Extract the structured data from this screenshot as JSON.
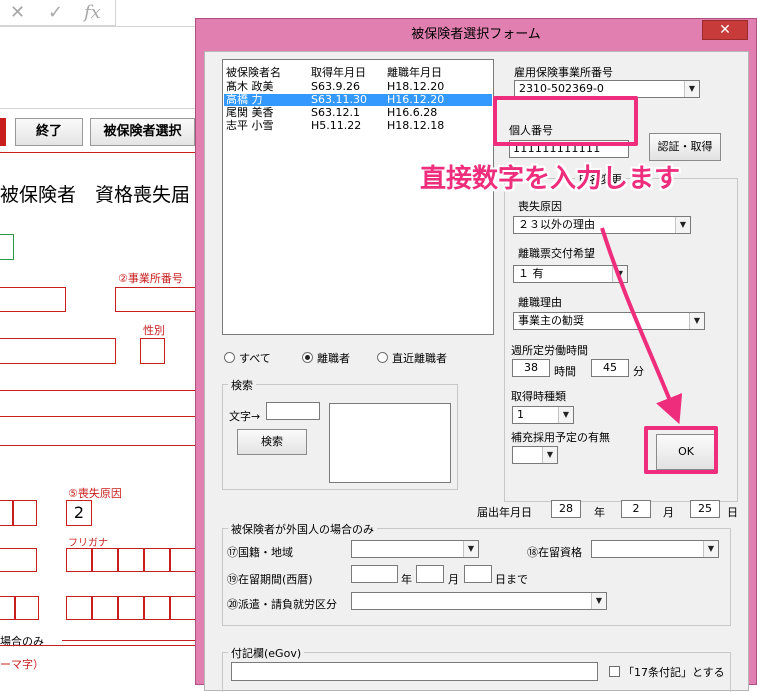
{
  "excel": {
    "toolbar": {
      "x": "✕",
      "check": "✓",
      "fx": "fx"
    },
    "buttons": {
      "exit": "終了",
      "select_insured": "被保険者選択"
    },
    "sheet_title": "被保険者　資格喪失届",
    "label_office_number": "②事業所番号",
    "label_gender": "性別",
    "label_loss_reason": "⑤喪失原因",
    "loss_reason_value": "2",
    "label_furigana": "フリガナ",
    "label_foreign_only": "場合のみ",
    "label_romaji": "ーマ字）"
  },
  "dialog": {
    "title": "被保険者選択フォーム",
    "close": "✕",
    "list": {
      "headers": [
        "被保険者名",
        "取得年月日",
        "離職年月日"
      ],
      "rows": [
        [
          "髙木 政美",
          "S63.9.26",
          "H18.12.20"
        ],
        [
          "高橋 力",
          "S63.11.30",
          "H16.12.20"
        ],
        [
          "尾関 美香",
          "S63.12.1",
          "H16.6.28"
        ],
        [
          "志平 小雪",
          "H5.11.22",
          "H18.12.18"
        ]
      ],
      "selected_index": 1
    },
    "filter": {
      "all": "すべて",
      "left": "離職者",
      "recent": "直近離職者",
      "selected": "left"
    },
    "search": {
      "group": "検索",
      "char_label": "文字→",
      "char_value": "",
      "button": "検索"
    },
    "office": {
      "label": "雇用保険事業所番号",
      "value": "2310-502369-0"
    },
    "personal": {
      "label": "個人番号",
      "value": "111111111111",
      "auth_button": "認証・取得"
    },
    "change_group_label": "氏名変更",
    "loss_reason": {
      "label": "喪失原因",
      "value": "２３以外の理由"
    },
    "separation_cert": {
      "label": "離職票交付希望",
      "value": "１ 有"
    },
    "separation_reason": {
      "label": "離職理由",
      "value": "事業主の勧奨"
    },
    "weekly_hours": {
      "label": "週所定労働時間",
      "hours": "38",
      "hours_unit": "時間",
      "minutes": "45",
      "minutes_unit": "分"
    },
    "acq_type": {
      "label": "取得時種類",
      "value": "1"
    },
    "supplementary": {
      "label": "補充採用予定の有無",
      "value": ""
    },
    "ok_button": "OK",
    "submit_date": {
      "label": "届出年月日",
      "year": "28",
      "year_unit": "年",
      "month": "2",
      "month_unit": "月",
      "day": "25",
      "day_unit": "日"
    },
    "foreign": {
      "group": "被保険者が外国人の場合のみ",
      "nationality_label": "⑰国籍・地域",
      "nationality_value": "",
      "status_label": "⑱在留資格",
      "status_value": "",
      "period_label": "⑲在留期間(西暦)",
      "period_year_unit": "年",
      "period_month_unit": "月",
      "period_day_unit": "日まで",
      "dispatch_label": "⑳派遣・請負就労区分",
      "dispatch_value": ""
    },
    "notes": {
      "group": "付記欄(eGov)",
      "value": "",
      "check_label": "「17条付記」とする"
    }
  },
  "annotation": {
    "callout": "直接数字を入力します",
    "color": "#ee2e7c"
  }
}
